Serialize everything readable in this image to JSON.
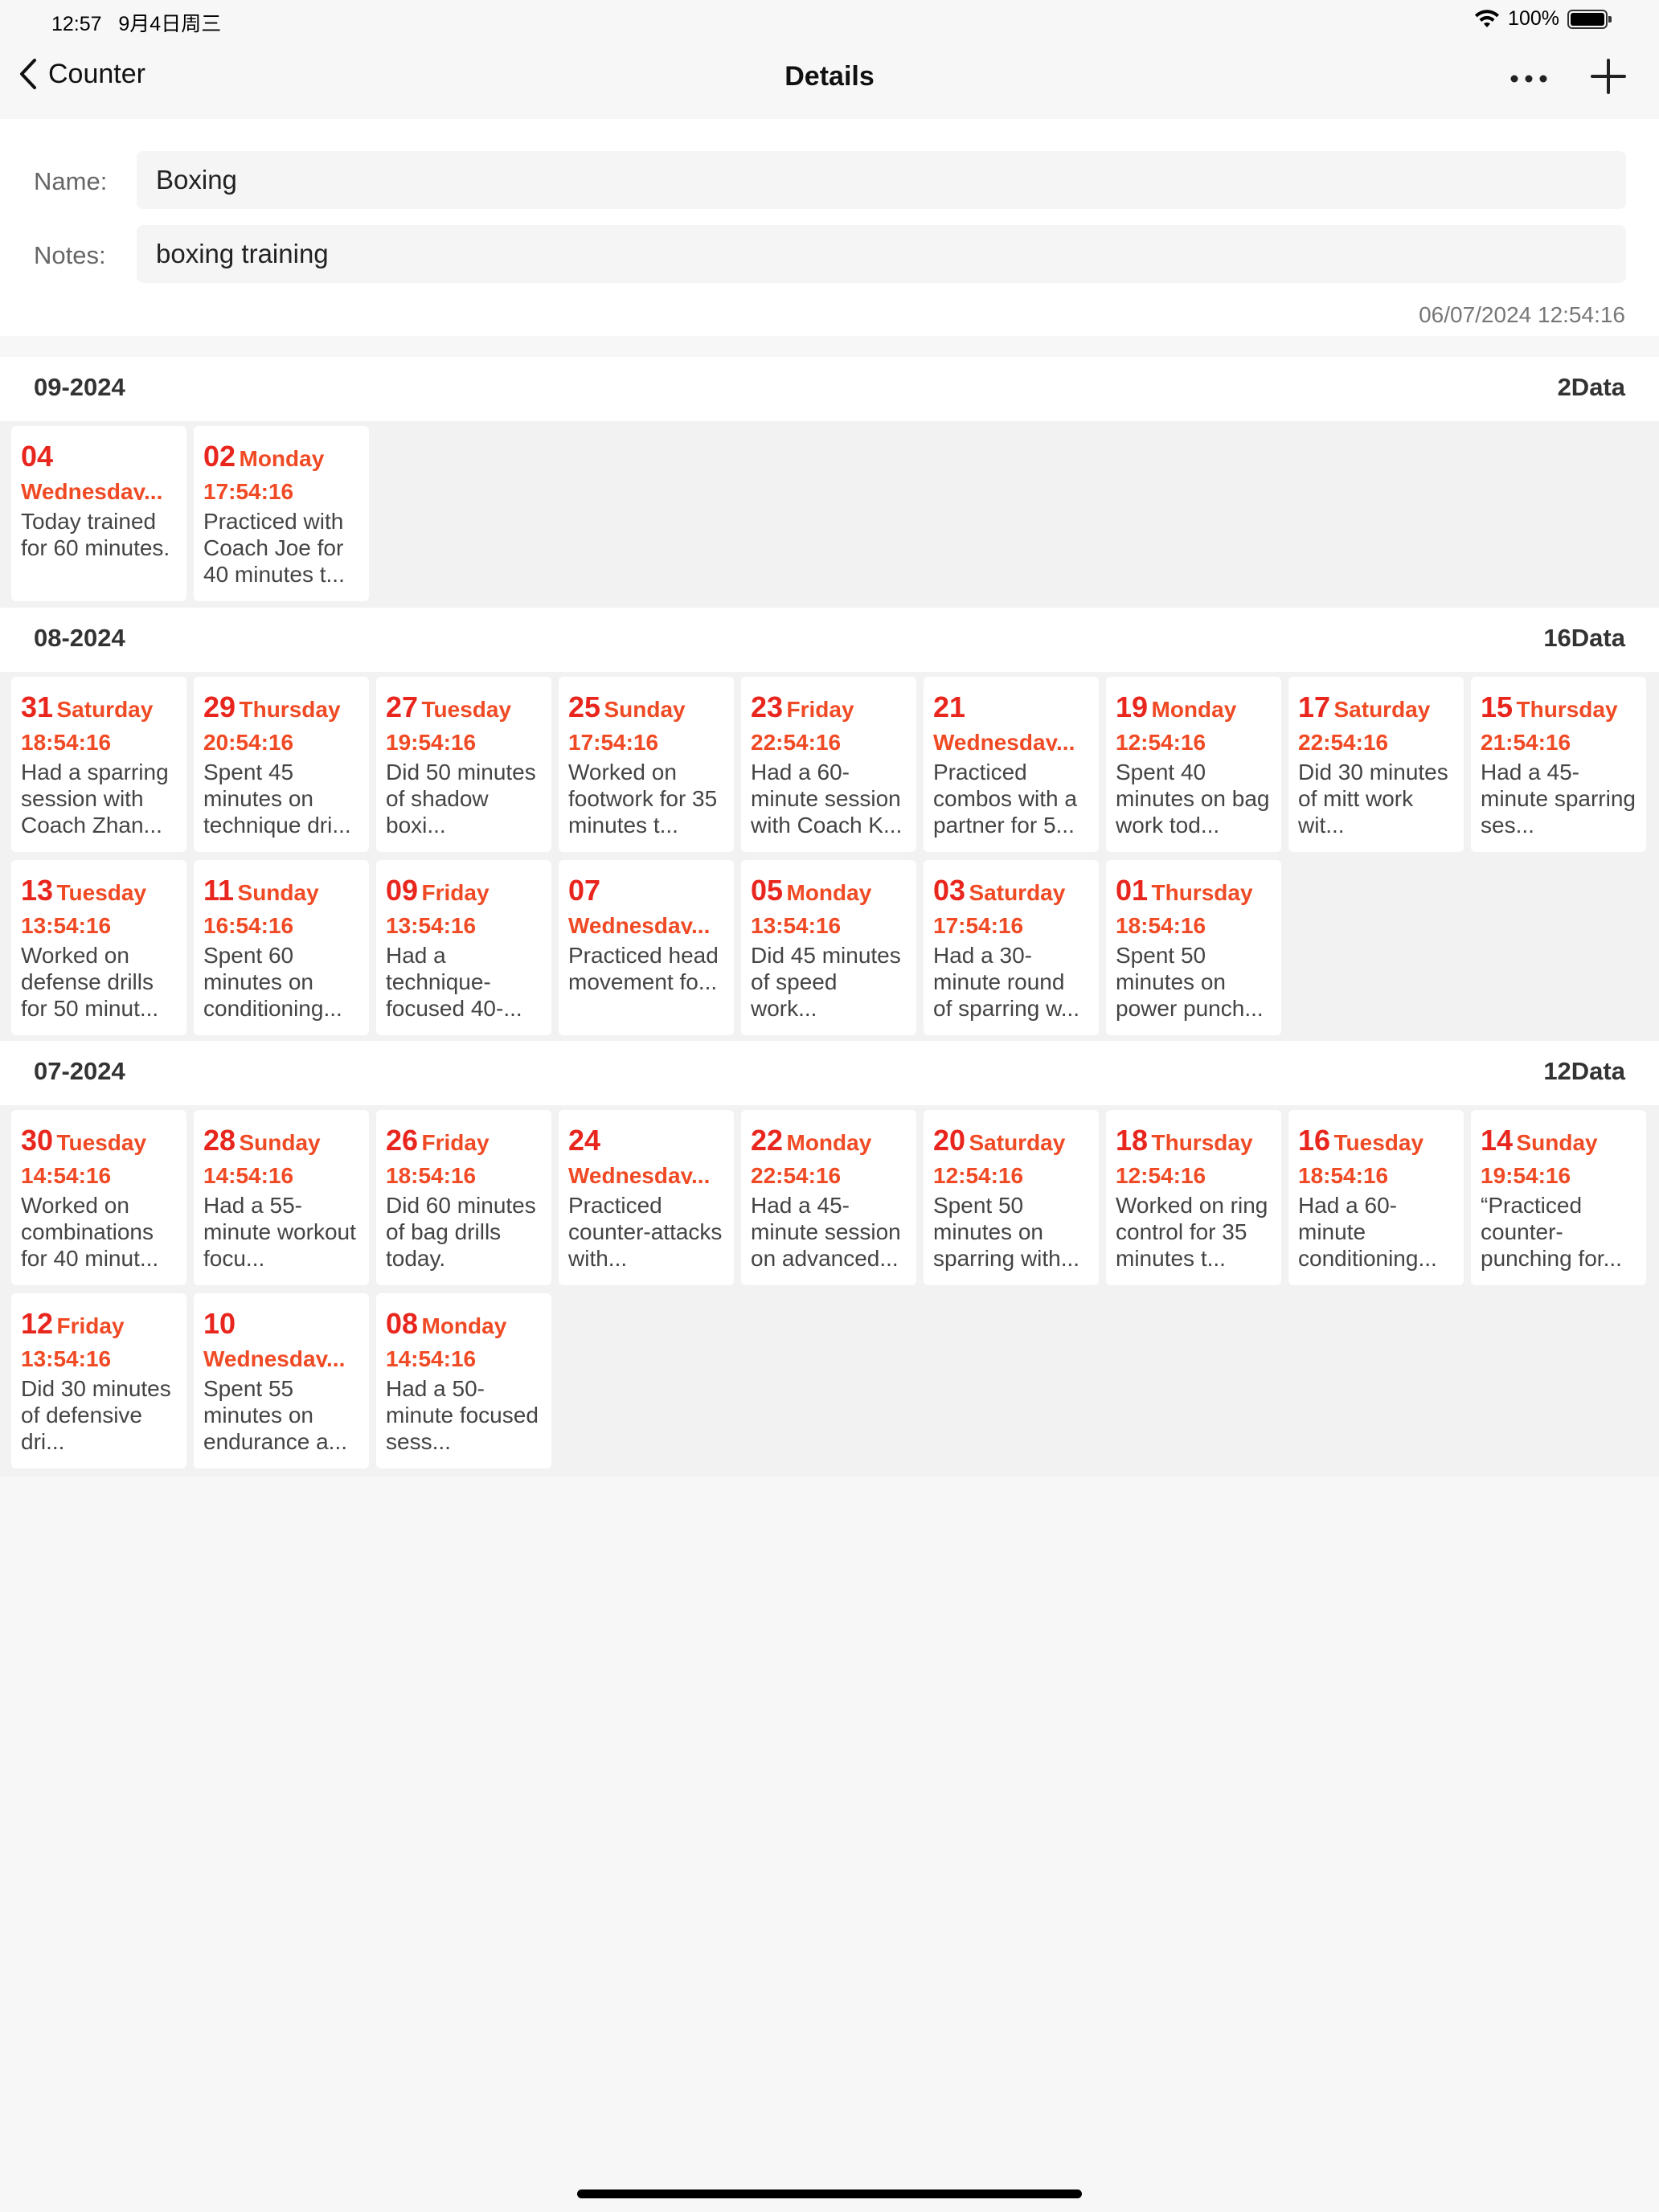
{
  "status_bar": {
    "time": "12:57",
    "date": "9月4日周三",
    "battery": "100%"
  },
  "nav": {
    "back_label": "Counter",
    "title": "Details"
  },
  "form": {
    "name_label": "Name:",
    "name_value": "Boxing",
    "notes_label": "Notes:",
    "notes_value": "boxing training",
    "created": "06/07/2024 12:54:16"
  },
  "months": [
    {
      "title": "09-2024",
      "count": "2Data",
      "entries": [
        {
          "day": "04",
          "weekday": "Wednesday...",
          "time": "",
          "note": "Today trained for 60 minutes."
        },
        {
          "day": "02",
          "weekday": "Monday",
          "time": "17:54:16",
          "note": "Practiced with Coach Joe for 40 minutes t..."
        }
      ]
    },
    {
      "title": "08-2024",
      "count": "16Data",
      "entries": [
        {
          "day": "31",
          "weekday": "Saturday",
          "time": "18:54:16",
          "note": "Had a sparring session with Coach Zhan..."
        },
        {
          "day": "29",
          "weekday": "Thursday",
          "time": "20:54:16",
          "note": "Spent 45 minutes on technique dri..."
        },
        {
          "day": "27",
          "weekday": "Tuesday",
          "time": "19:54:16",
          "note": "Did 50 minutes of shadow boxi..."
        },
        {
          "day": "25",
          "weekday": "Sunday",
          "time": "17:54:16",
          "note": "Worked on footwork for 35 minutes t..."
        },
        {
          "day": "23",
          "weekday": "Friday",
          "time": "22:54:16",
          "note": "Had a 60-minute session with Coach K..."
        },
        {
          "day": "21",
          "weekday": "Wednesday...",
          "time": "",
          "note": "Practiced combos with a partner for 5..."
        },
        {
          "day": "19",
          "weekday": "Monday",
          "time": "12:54:16",
          "note": "Spent 40 minutes on bag work tod..."
        },
        {
          "day": "17",
          "weekday": "Saturday",
          "time": "22:54:16",
          "note": "Did 30 minutes of mitt work wit..."
        },
        {
          "day": "15",
          "weekday": "Thursday",
          "time": "21:54:16",
          "note": "Had a 45-minute sparring ses..."
        },
        {
          "day": "13",
          "weekday": "Tuesday",
          "time": "13:54:16",
          "note": "Worked on defense drills for 50 minut..."
        },
        {
          "day": "11",
          "weekday": "Sunday",
          "time": "16:54:16",
          "note": "Spent 60 minutes on conditioning..."
        },
        {
          "day": "09",
          "weekday": "Friday",
          "time": "13:54:16",
          "note": "Had a technique-focused 40-..."
        },
        {
          "day": "07",
          "weekday": "Wednesday...",
          "time": "",
          "note": "Practiced head movement fo..."
        },
        {
          "day": "05",
          "weekday": "Monday",
          "time": "13:54:16",
          "note": "Did 45 minutes of speed work..."
        },
        {
          "day": "03",
          "weekday": "Saturday",
          "time": "17:54:16",
          "note": "Had a 30-minute round of sparring w..."
        },
        {
          "day": "01",
          "weekday": "Thursday",
          "time": "18:54:16",
          "note": "Spent 50 minutes on power punch..."
        }
      ]
    },
    {
      "title": "07-2024",
      "count": "12Data",
      "entries": [
        {
          "day": "30",
          "weekday": "Tuesday",
          "time": "14:54:16",
          "note": "Worked on combinations for 40 minut..."
        },
        {
          "day": "28",
          "weekday": "Sunday",
          "time": "14:54:16",
          "note": "Had a 55-minute workout focu..."
        },
        {
          "day": "26",
          "weekday": "Friday",
          "time": "18:54:16",
          "note": "Did 60 minutes of bag drills today."
        },
        {
          "day": "24",
          "weekday": "Wednesday...",
          "time": "",
          "note": "Practiced counter-attacks with..."
        },
        {
          "day": "22",
          "weekday": "Monday",
          "time": "22:54:16",
          "note": "Had a 45-minute session on advanced..."
        },
        {
          "day": "20",
          "weekday": "Saturday",
          "time": "12:54:16",
          "note": "Spent 50 minutes on sparring with..."
        },
        {
          "day": "18",
          "weekday": "Thursday",
          "time": "12:54:16",
          "note": "Worked on ring control for 35 minutes t..."
        },
        {
          "day": "16",
          "weekday": "Tuesday",
          "time": "18:54:16",
          "note": "Had a 60-minute conditioning..."
        },
        {
          "day": "14",
          "weekday": "Sunday",
          "time": "19:54:16",
          "note": "“Practiced counter-punching for..."
        },
        {
          "day": "12",
          "weekday": "Friday",
          "time": "13:54:16",
          "note": "Did 30 minutes of defensive dri..."
        },
        {
          "day": "10",
          "weekday": "Wednesday...",
          "time": "",
          "note": "Spent 55 minutes on endurance a..."
        },
        {
          "day": "08",
          "weekday": "Monday",
          "time": "14:54:16",
          "note": "Had a 50-minute focused sess..."
        }
      ]
    }
  ]
}
